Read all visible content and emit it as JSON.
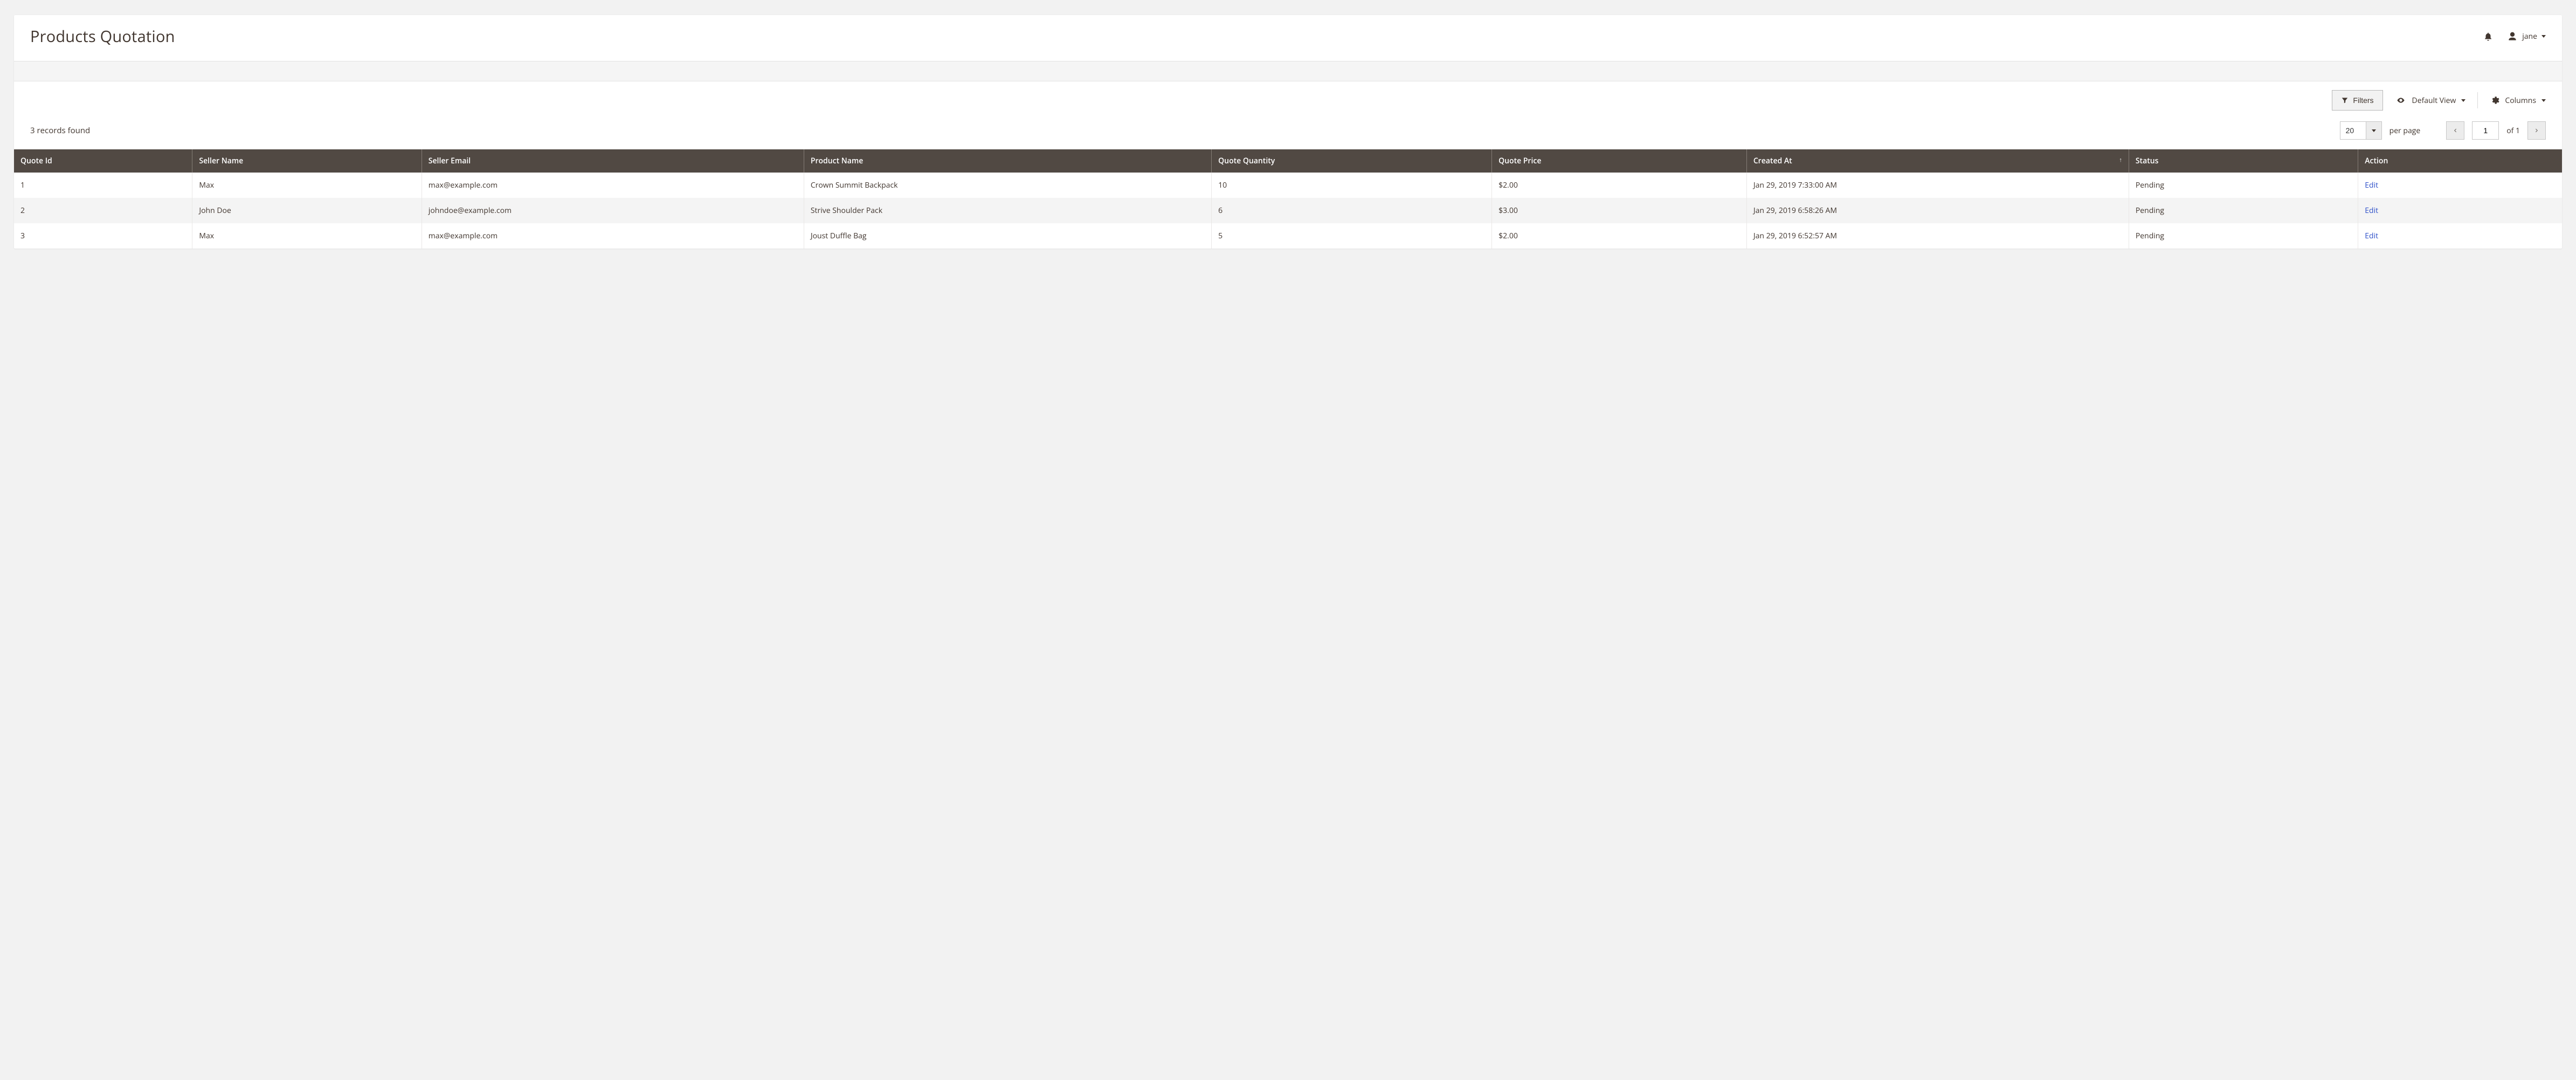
{
  "header": {
    "title": "Products Quotation",
    "user_name": "jane"
  },
  "toolbar": {
    "filters_label": "Filters",
    "view_label": "Default View",
    "columns_label": "Columns"
  },
  "meta": {
    "records_found_text": "3 records found",
    "per_page_value": "20",
    "per_page_label": "per page",
    "current_page": "1",
    "total_pages_text": "of 1"
  },
  "table": {
    "columns": [
      "Quote Id",
      "Seller Name",
      "Seller Email",
      "Product Name",
      "Quote Quantity",
      "Quote Price",
      "Created At",
      "Status",
      "Action"
    ],
    "sort_column_index": 6,
    "sort_indicator": "↑",
    "rows": [
      {
        "quote_id": "1",
        "seller_name": "Max",
        "seller_email": "max@example.com",
        "product_name": "Crown Summit Backpack",
        "quote_quantity": "10",
        "quote_price": "$2.00",
        "created_at": "Jan 29, 2019 7:33:00 AM",
        "status": "Pending",
        "action_label": "Edit"
      },
      {
        "quote_id": "2",
        "seller_name": "John Doe",
        "seller_email": "johndoe@example.com",
        "product_name": "Strive Shoulder Pack",
        "quote_quantity": "6",
        "quote_price": "$3.00",
        "created_at": "Jan 29, 2019 6:58:26 AM",
        "status": "Pending",
        "action_label": "Edit"
      },
      {
        "quote_id": "3",
        "seller_name": "Max",
        "seller_email": "max@example.com",
        "product_name": "Joust Duffle Bag",
        "quote_quantity": "5",
        "quote_price": "$2.00",
        "created_at": "Jan 29, 2019 6:52:57 AM",
        "status": "Pending",
        "action_label": "Edit"
      }
    ]
  }
}
